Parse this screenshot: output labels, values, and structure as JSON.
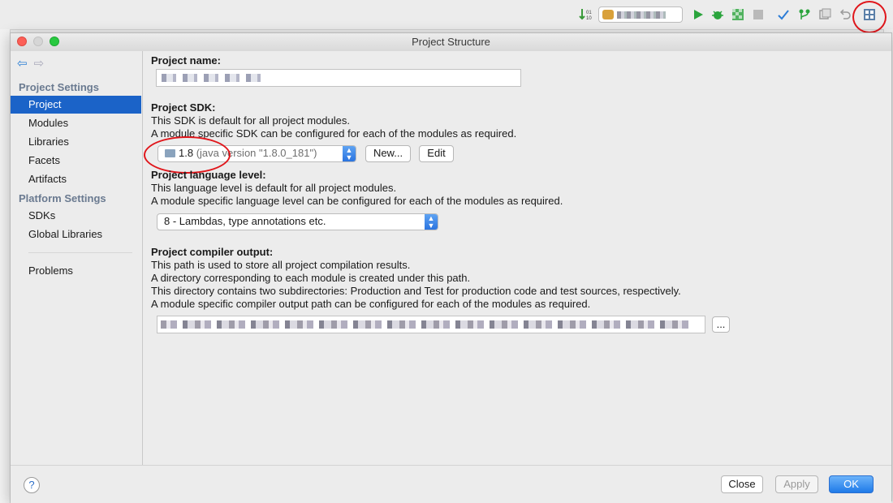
{
  "dialog": {
    "title": "Project Structure"
  },
  "sidebar": {
    "project_settings_header": "Project Settings",
    "platform_settings_header": "Platform Settings",
    "items": [
      {
        "label": "Project"
      },
      {
        "label": "Modules"
      },
      {
        "label": "Libraries"
      },
      {
        "label": "Facets"
      },
      {
        "label": "Artifacts"
      },
      {
        "label": "SDKs"
      },
      {
        "label": "Global Libraries"
      },
      {
        "label": "Problems"
      }
    ],
    "selected": "Project"
  },
  "project_name": {
    "label": "Project name:"
  },
  "project_sdk": {
    "label": "Project SDK:",
    "desc1": "This SDK is default for all project modules.",
    "desc2": "A module specific SDK can be configured for each of the modules as required.",
    "selected_version": "1.8",
    "selected_detail": "(java version \"1.8.0_181\")",
    "new_label": "New...",
    "edit_label": "Edit"
  },
  "language_level": {
    "label": "Project language level:",
    "desc1": "This language level is default for all project modules.",
    "desc2": "A module specific language level can be configured for each of the modules as required.",
    "selected": "8 - Lambdas, type annotations etc."
  },
  "compiler_output": {
    "label": "Project compiler output:",
    "desc1": "This path is used to store all project compilation results.",
    "desc2": "A directory corresponding to each module is created under this path.",
    "desc3": "This directory contains two subdirectories: Production and Test for production code and test sources, respectively.",
    "desc4": "A module specific compiler output path can be configured for each of the modules as required.",
    "browse_label": "..."
  },
  "footer": {
    "help": "?",
    "close": "Close",
    "apply": "Apply",
    "ok": "OK"
  },
  "colors": {
    "accent": "#1b63c8",
    "annotation": "#e0161b"
  }
}
